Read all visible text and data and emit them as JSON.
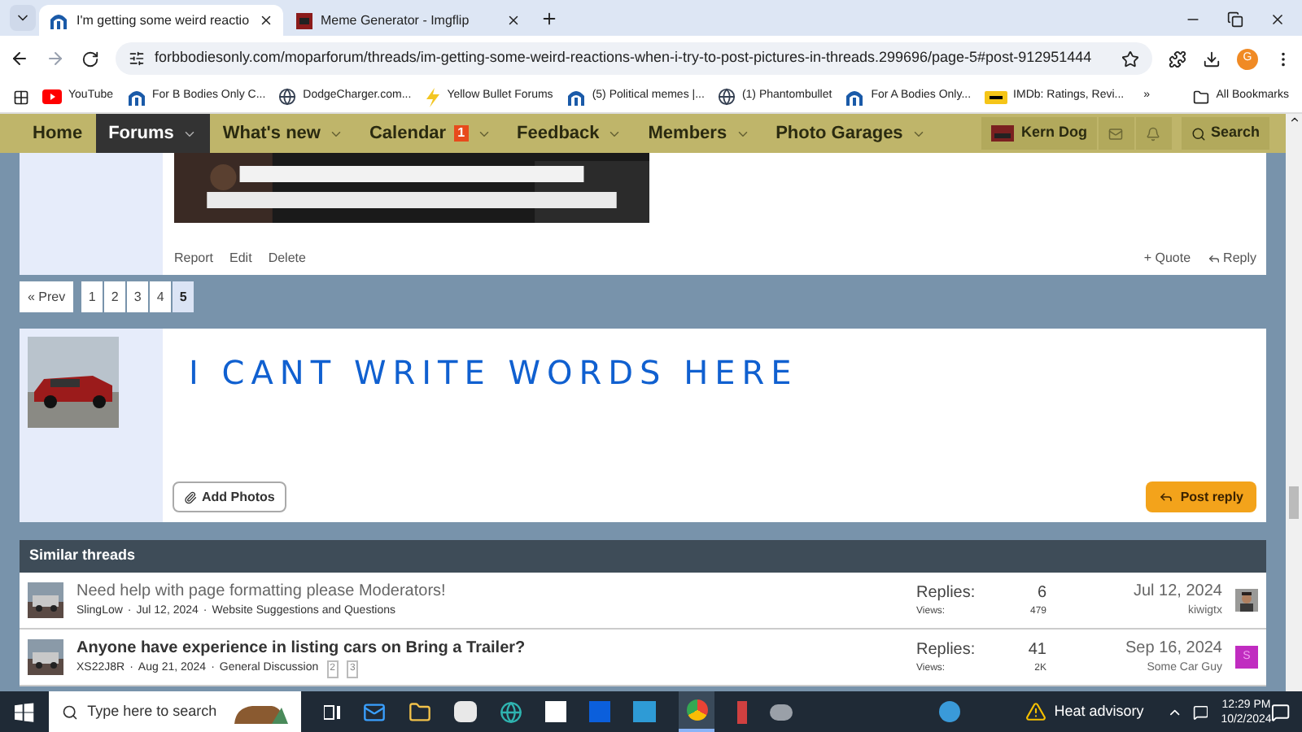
{
  "browser": {
    "tabs": [
      {
        "title": "I'm getting some weird reactio",
        "selected": true
      },
      {
        "title": "Meme Generator - Imgflip",
        "selected": false
      }
    ],
    "url": "forbbodiesonly.com/moparforum/threads/im-getting-some-weird-reactions-when-i-try-to-post-pictures-in-threads.299696/page-5#post-912951444",
    "profile_initial": "G",
    "bookmarks": [
      {
        "label": "YouTube",
        "kind": "youtube"
      },
      {
        "label": "For B Bodies Only C...",
        "kind": "mopar"
      },
      {
        "label": "DodgeCharger.com...",
        "kind": "globe"
      },
      {
        "label": "Yellow Bullet Forums",
        "kind": "yellow"
      },
      {
        "label": "(5) Political memes |...",
        "kind": "mopar"
      },
      {
        "label": "(1) Phantombullet",
        "kind": "globe"
      },
      {
        "label": "For A Bodies Only...",
        "kind": "mopar"
      },
      {
        "label": "IMDb: Ratings, Revi...",
        "kind": "imdb"
      }
    ],
    "more_bookmarks": "»",
    "all_bookmarks": "All Bookmarks"
  },
  "nav": {
    "items": [
      {
        "label": "Home",
        "selected": false,
        "dropdown": false
      },
      {
        "label": "Forums",
        "selected": true,
        "dropdown": true
      },
      {
        "label": "What's new",
        "selected": false,
        "dropdown": true
      },
      {
        "label": "Calendar",
        "selected": false,
        "dropdown": true,
        "badge": "1"
      },
      {
        "label": "Feedback",
        "selected": false,
        "dropdown": true
      },
      {
        "label": "Members",
        "selected": false,
        "dropdown": true
      },
      {
        "label": "Photo Garages",
        "selected": false,
        "dropdown": true
      }
    ],
    "user": "Kern Dog",
    "search": "Search"
  },
  "post": {
    "actions": [
      "Report",
      "Edit",
      "Delete"
    ],
    "quote": "+ Quote",
    "reply": "Reply"
  },
  "pagination": {
    "prev": "« Prev",
    "pages": [
      {
        "label": "1",
        "selected": false
      },
      {
        "label": "2",
        "selected": false
      },
      {
        "label": "3",
        "selected": false
      },
      {
        "label": "4",
        "selected": false
      },
      {
        "label": "5",
        "selected": true
      }
    ]
  },
  "reply_box": {
    "content": "I CANT WRITE WORDS HERE",
    "add_photos": "Add Photos",
    "post_reply": "Post reply"
  },
  "similar_threads": {
    "title": "Similar threads",
    "meta_separator": "·",
    "threads": [
      {
        "title": "Need help with page formatting please Moderators!",
        "unread": false,
        "author": "SlingLow",
        "date": "Jul 12, 2024",
        "forum": "Website Suggestions and Questions",
        "replies_label": "Replies:",
        "replies": "6",
        "views_label": "Views:",
        "views": "479",
        "last_date": "Jul 12, 2024",
        "last_user": "kiwigtx"
      },
      {
        "title": "Anyone have experience in listing cars on Bring a Trailer?",
        "unread": true,
        "author": "XS22J8R",
        "date": "Aug 21, 2024",
        "forum": "General Discussion",
        "pages": [
          "2",
          "3"
        ],
        "replies_label": "Replies:",
        "replies": "41",
        "views_label": "Views:",
        "views": "2K",
        "last_date": "Sep 16, 2024",
        "last_user": "Some Car Guy",
        "avatar": {
          "kind": "letter",
          "letter": "S",
          "color": "#c02cc0"
        }
      }
    ]
  },
  "taskbar": {
    "search_placeholder": "Type here to search",
    "weather": "Heat advisory",
    "time": "12:29 PM",
    "date": "10/2/2024"
  }
}
